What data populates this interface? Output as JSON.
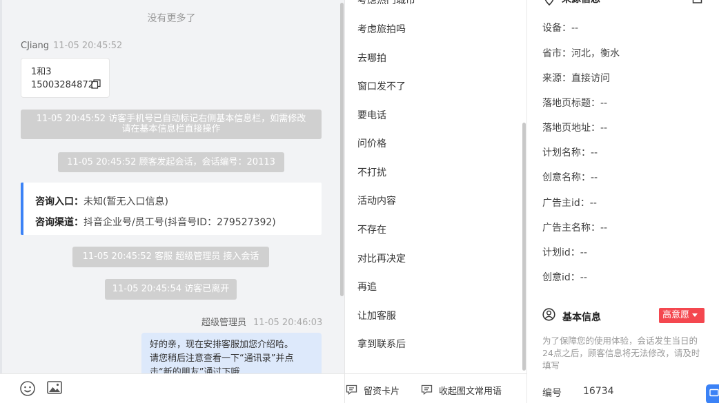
{
  "chat": {
    "no_more": "没有更多了",
    "msg1": {
      "sender": "CJiang",
      "time": "11-05 20:45:52",
      "lines": [
        "1和3",
        "15003284872"
      ]
    },
    "sys1": [
      "11-05 20:45:52 访客手机号已自动标记右侧基本信息栏，如需修改",
      "请在基本信息栏直接操作"
    ],
    "sys2": "11-05 20:45:52 顾客发起会话，会话编号：20113",
    "card": {
      "entry_label": "咨询入口：",
      "entry_value": "未知(暂无入口信息)",
      "channel_label": "咨询渠道：",
      "channel_value": "抖音企业号/员工号(抖音号ID：279527392)"
    },
    "sys3": "11-05 20:45:52 客服 超级管理员 接入会话",
    "sys4": "11-05 20:45:54 访客已离开",
    "msg2": {
      "sender": "超级管理员",
      "time": "11-05 20:46:03",
      "lines": [
        "好的亲，现在安排客服加您介绍哈。",
        "请您稍后注意查看一下“通讯录”并点",
        "击“新的朋友”通过下哦"
      ]
    },
    "tools": {
      "emoji": "emoji-icon",
      "image": "image-icon"
    }
  },
  "quick_replies": {
    "top_partial": "考虑热门城市",
    "items": [
      "考虑旅拍吗",
      "去哪拍",
      "窗口发不了",
      "要电话",
      "问价格",
      "不打扰",
      "活动内容",
      "不存在",
      "对比再决定",
      "再追",
      "让加客服",
      "拿到联系后"
    ],
    "bottom": {
      "card_label": "留资卡片",
      "collapse_label": "收起图文常用语"
    }
  },
  "info": {
    "source_title": "来源信息",
    "rows": [
      "设备：--",
      "省市：河北，衡水",
      "来源：直接访问",
      "落地页标题：--",
      "落地页地址：--",
      "计划名称：--",
      "创意名称：--",
      "广告主id：--",
      "广告主名称：--",
      "计划id：--",
      "创意id：--"
    ],
    "basic_title": "基本信息",
    "intent_badge": "高意愿",
    "note": "为了保障您的使用体验，会话发生当日的24点之后，顾客信息将无法修改，请及时填写",
    "number_label": "编号",
    "number_value": "16734"
  },
  "colors": {
    "accent": "#3b82f6",
    "badge": "#f4474f",
    "system_bubble": "#d0d0d0",
    "agent_bubble": "#dde9fb"
  }
}
